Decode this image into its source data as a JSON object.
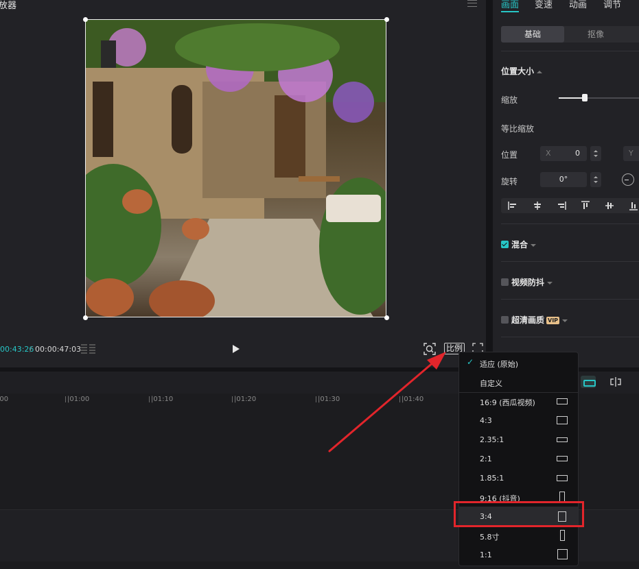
{
  "player": {
    "title": "放器",
    "time_current": "00:43:26",
    "time_separator": "/",
    "time_total": "00:00:47:03",
    "ratio_label": "比例"
  },
  "right_panel": {
    "tabs": [
      "画面",
      "变速",
      "动画",
      "调节"
    ],
    "active_tab": "画面",
    "sub_tabs": [
      "基础",
      "抠像"
    ],
    "position_size": {
      "title": "位置大小",
      "scale_label": "缩放",
      "scale_level": 0.26,
      "uniform_scale_label": "等比缩放",
      "position_label": "位置",
      "x_axis": "X",
      "x_value": "0",
      "y_axis": "Y",
      "rotate_label": "旋转",
      "rotate_value": "0°"
    },
    "blend_label": "混合",
    "stabilize_label": "视频防抖",
    "hd_label": "超清画质",
    "vip_label": "VIP"
  },
  "timeline": {
    "ticks": [
      "|00",
      "|01:00",
      "|01:10",
      "|01:20",
      "|01:30",
      "|01:40"
    ]
  },
  "ratio_dropdown": {
    "items": [
      {
        "label": "适应 (原始)",
        "checked": true
      },
      {
        "label": "自定义"
      },
      {
        "label": "16:9 (西瓜视频)"
      },
      {
        "label": "4:3"
      },
      {
        "label": "2.35:1"
      },
      {
        "label": "2:1"
      },
      {
        "label": "1.85:1"
      },
      {
        "label": "9:16 (抖音)"
      },
      {
        "label": "3:4",
        "highlighted": true
      },
      {
        "label": "5.8寸"
      },
      {
        "label": "1:1"
      }
    ]
  },
  "colors": {
    "accent": "#27c6c6",
    "annotation": "#e2252b",
    "background": "#141417",
    "panel": "#222226"
  }
}
